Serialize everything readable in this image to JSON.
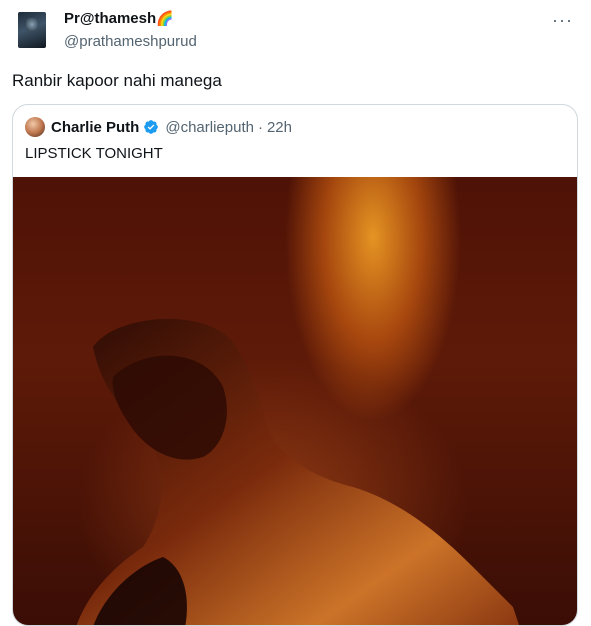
{
  "author": {
    "display_name": "Pr@thamesh",
    "flag_emoji": "🌈",
    "handle": "@prathameshpurud",
    "avatar_icon": "profile-avatar"
  },
  "more_icon": "more-options-icon",
  "tweet": {
    "text": "Ranbir kapoor nahi manega"
  },
  "quoted_tweet": {
    "display_name": "Charlie Puth",
    "verified": true,
    "verified_color": "#1d9bf0",
    "handle": "@charlieputh",
    "separator": "·",
    "time": "22h",
    "text": "LIPSTICK TONIGHT",
    "media_description_color": "#5e1a08"
  },
  "colors": {
    "text_primary": "#0f1419",
    "text_secondary": "#536471",
    "border": "#cfd9de"
  }
}
